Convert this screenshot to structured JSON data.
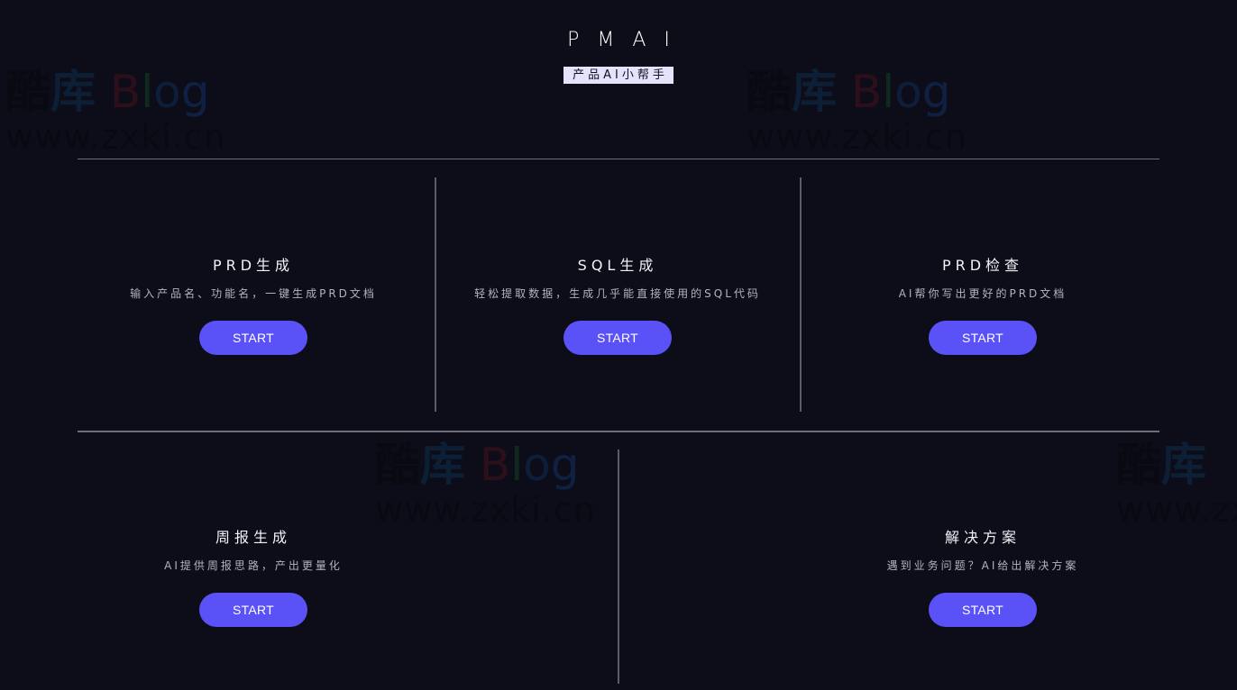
{
  "header": {
    "logo": "PMAI",
    "tagline": "产品AI小帮手"
  },
  "cards": [
    {
      "title": "PRD生成",
      "description": "输入产品名、功能名，一键生成PRD文档",
      "button": "START"
    },
    {
      "title": "SQL生成",
      "description": "轻松提取数据，生成几乎能直接使用的SQL代码",
      "button": "START"
    },
    {
      "title": "PRD检查",
      "description": "AI帮你写出更好的PRD文档",
      "button": "START"
    },
    {
      "title": "周报生成",
      "description": "AI提供周报思路，产出更量化",
      "button": "START"
    },
    {
      "title": "解决方案",
      "description": "遇到业务问题？AI给出解决方案",
      "button": "START"
    }
  ],
  "watermark": {
    "name_cn": "酷库",
    "name_en": "Blog",
    "url": "www.zxki.cn"
  },
  "colors": {
    "background": "#0d0d1a",
    "accent": "#5a52f7",
    "tagline_bg": "#e5e3fb",
    "divider": "#6e6e7a"
  }
}
